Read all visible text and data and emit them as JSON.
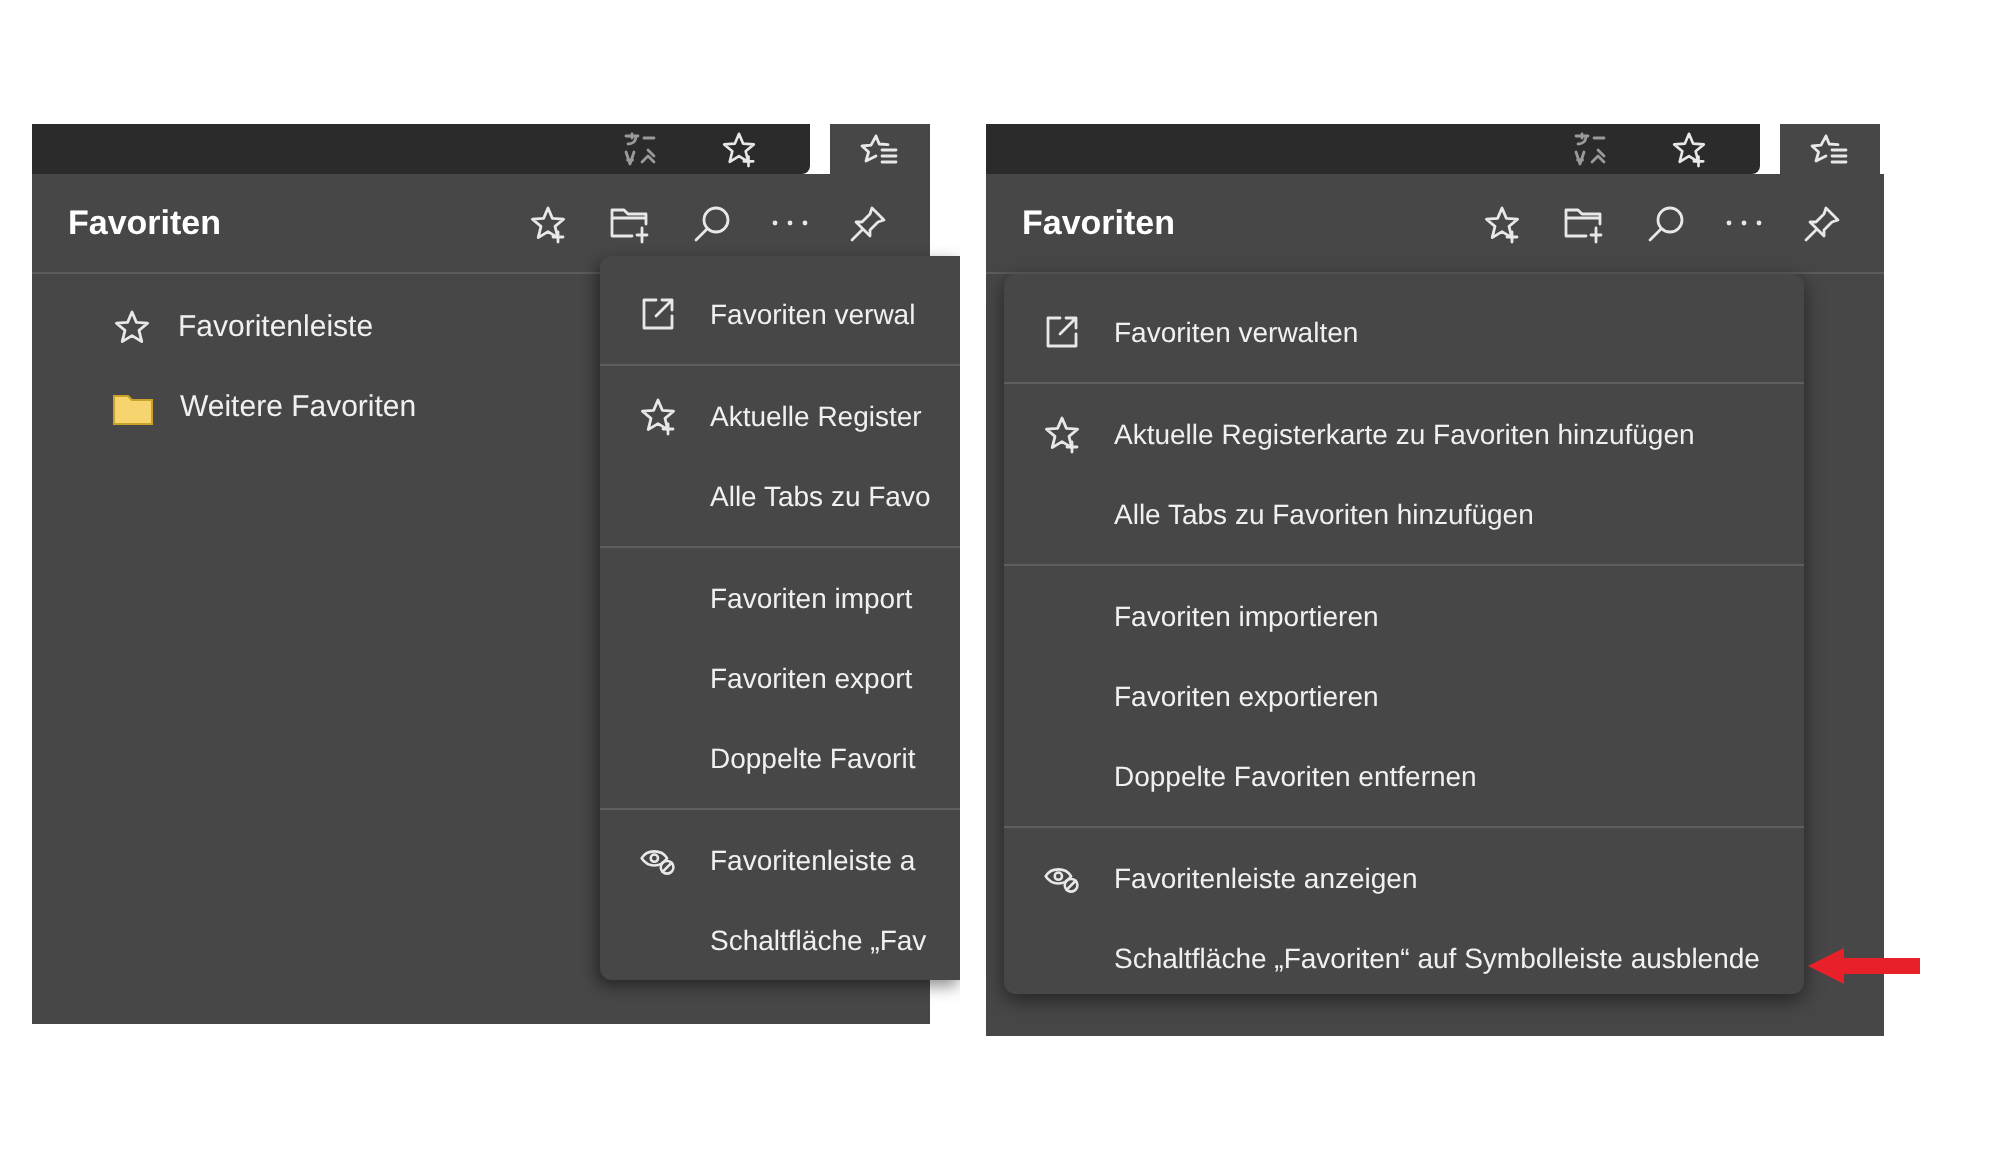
{
  "screenshots": [
    {
      "panel": {
        "title": "Favoriten",
        "items": [
          {
            "label": "Favoritenleiste",
            "kind": "star"
          },
          {
            "label": "Weitere Favoriten",
            "kind": "folder"
          }
        ]
      },
      "menu": {
        "groups": [
          [
            {
              "label": "Favoriten verwal",
              "kind": "external"
            }
          ],
          [
            {
              "label": "Aktuelle Register",
              "kind": "star-plus"
            },
            {
              "label": "Alle Tabs zu Favo",
              "kind": "plain"
            }
          ],
          [
            {
              "label": "Favoriten import",
              "kind": "plain"
            },
            {
              "label": "Favoriten export",
              "kind": "plain"
            },
            {
              "label": "Doppelte Favorit",
              "kind": "plain"
            }
          ],
          [
            {
              "label": "Favoritenleiste a",
              "kind": "eye-off"
            },
            {
              "label": "Schaltfläche „Fav",
              "kind": "plain"
            }
          ]
        ]
      }
    },
    {
      "panel": {
        "title": "Favoriten"
      },
      "menu": {
        "groups": [
          [
            {
              "label": "Favoriten verwalten",
              "kind": "external"
            }
          ],
          [
            {
              "label": "Aktuelle Registerkarte zu Favoriten hinzufügen",
              "kind": "star-plus"
            },
            {
              "label": "Alle Tabs zu Favoriten hinzufügen",
              "kind": "plain"
            }
          ],
          [
            {
              "label": "Favoriten importieren",
              "kind": "plain"
            },
            {
              "label": "Favoriten exportieren",
              "kind": "plain"
            },
            {
              "label": "Doppelte Favoriten entfernen",
              "kind": "plain"
            }
          ],
          [
            {
              "label": "Favoritenleiste anzeigen",
              "kind": "eye-off"
            },
            {
              "label": "Schaltfläche „Favoriten“ auf Symbolleiste ausblende",
              "kind": "plain"
            }
          ]
        ]
      }
    }
  ]
}
